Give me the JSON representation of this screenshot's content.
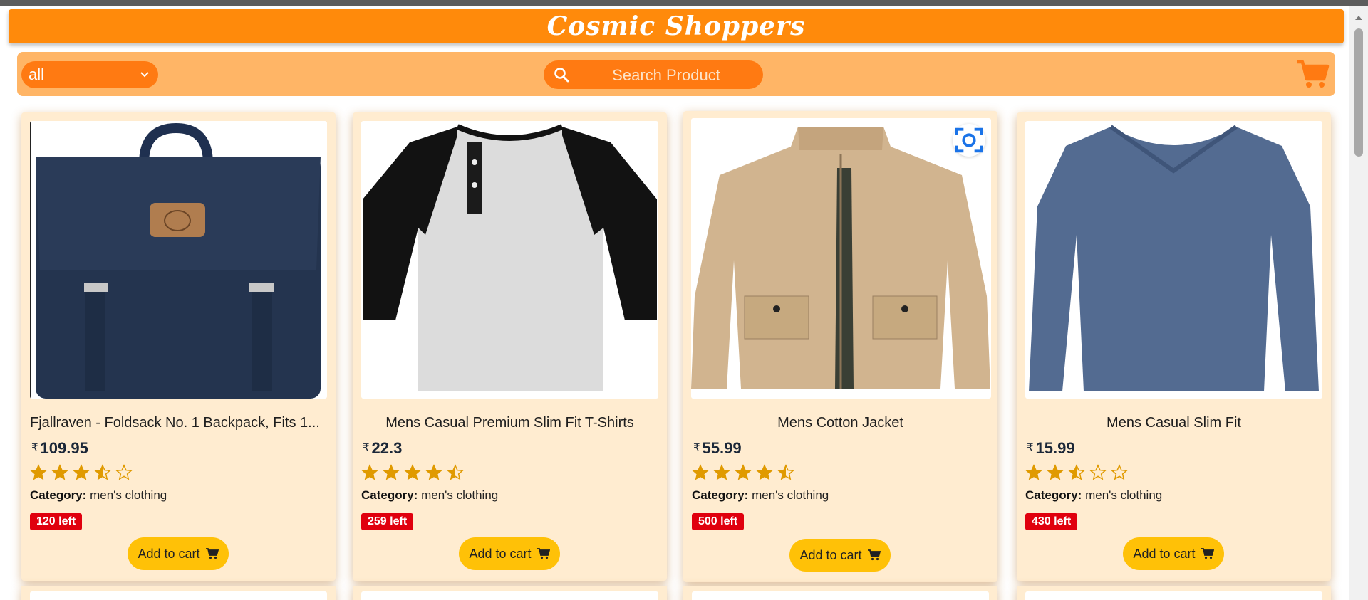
{
  "header": {
    "brand": "Cosmic Shoppers"
  },
  "toolbar": {
    "category_select": {
      "value": "all"
    },
    "search": {
      "placeholder": "Search Product",
      "value": ""
    },
    "cart_icon": "cart-icon"
  },
  "colors": {
    "header_bg": "#ff8a0b",
    "toolbar_bg": "#ffb566",
    "card_bg": "#ffecd0",
    "accent_button": "#ffc107",
    "stock_badge": "#e0000e",
    "star": "#e09a00"
  },
  "labels": {
    "currency": "₹",
    "category_prefix": "Category:",
    "add_to_cart": "Add to cart"
  },
  "products": [
    {
      "title": "Fjallraven - Foldsack No. 1 Backpack, Fits 1...",
      "price": "109.95",
      "rating": 3.5,
      "category": "men's clothing",
      "stock": "120 left",
      "image_icon": "backpack-image"
    },
    {
      "title": "Mens Casual Premium Slim Fit T-Shirts",
      "price": "22.3",
      "rating": 4.5,
      "category": "men's clothing",
      "stock": "259 left",
      "image_icon": "tshirt-image"
    },
    {
      "title": "Mens Cotton Jacket",
      "price": "55.99",
      "rating": 4.5,
      "category": "men's clothing",
      "stock": "500 left",
      "image_icon": "jacket-image"
    },
    {
      "title": "Mens Casual Slim Fit",
      "price": "15.99",
      "rating": 2.5,
      "category": "men's clothing",
      "stock": "430 left",
      "image_icon": "longsleeve-image"
    }
  ]
}
